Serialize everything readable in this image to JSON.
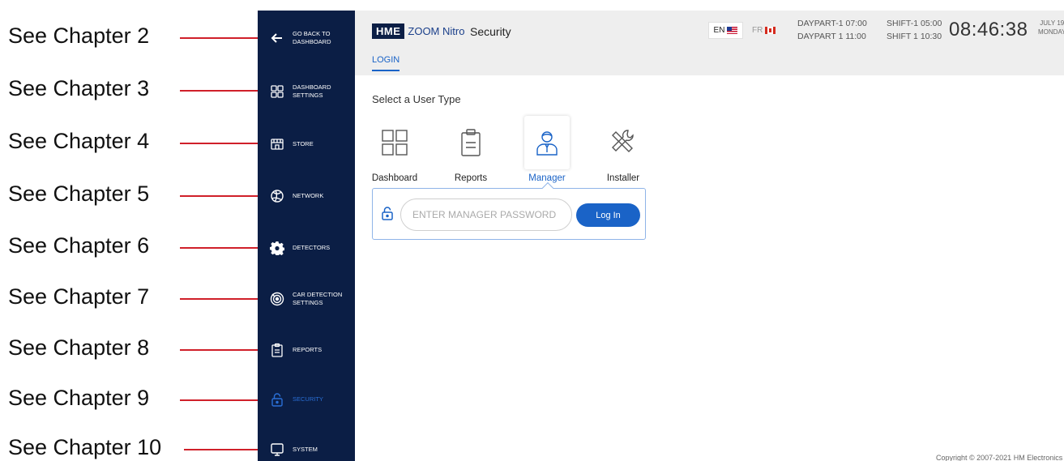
{
  "callouts": [
    "See Chapter 2",
    "See Chapter 3",
    "See Chapter 4",
    "See Chapter 5",
    "See Chapter 6",
    "See Chapter 7",
    "See Chapter 8",
    "See Chapter 9",
    "See Chapter 10"
  ],
  "sidebar": {
    "items": [
      {
        "label": "GO BACK TO DASHBOARD",
        "icon": "arrow-left-icon"
      },
      {
        "label": "DASHBOARD SETTINGS",
        "icon": "grid-icon"
      },
      {
        "label": "STORE",
        "icon": "store-icon"
      },
      {
        "label": "NETWORK",
        "icon": "network-icon"
      },
      {
        "label": "DETECTORS",
        "icon": "gear-icon"
      },
      {
        "label": "CAR DETECTION SETTINGS",
        "icon": "radar-icon"
      },
      {
        "label": "REPORTS",
        "icon": "clipboard-icon"
      },
      {
        "label": "SECURITY",
        "icon": "lock-icon",
        "active": true
      },
      {
        "label": "SYSTEM",
        "icon": "monitor-icon"
      }
    ]
  },
  "header": {
    "logo_brand": "HME",
    "logo_product": "ZOOM Nitro",
    "title": "Security",
    "tab": "LOGIN",
    "lang_en": "EN",
    "lang_fr": "FR",
    "daypart_1": "DAYPART-1 07:00",
    "shift_1": "SHIFT-1 05:00",
    "daypart_2": "DAYPART 1 11:00",
    "shift_2": "SHIFT 1 10:30",
    "time": "08:46:38",
    "date_line1": "JULY 19",
    "date_line2": "MONDAY"
  },
  "main": {
    "select_label": "Select a User Type",
    "user_types": [
      {
        "label": "Dashboard",
        "icon": "dashboard-grid-icon"
      },
      {
        "label": "Reports",
        "icon": "clipboard-icon"
      },
      {
        "label": "Manager",
        "icon": "manager-icon",
        "selected": true
      },
      {
        "label": "Installer",
        "icon": "tools-icon"
      }
    ],
    "password_placeholder": "ENTER MANAGER PASSWORD",
    "password_value": "",
    "login_button": "Log In"
  },
  "footer": {
    "copyright": "Copyright © 2007-2021 HM Electronics"
  },
  "colors": {
    "sidebar_bg": "#0b1e45",
    "accent": "#1a63c7",
    "callout_line": "#d0202a"
  }
}
